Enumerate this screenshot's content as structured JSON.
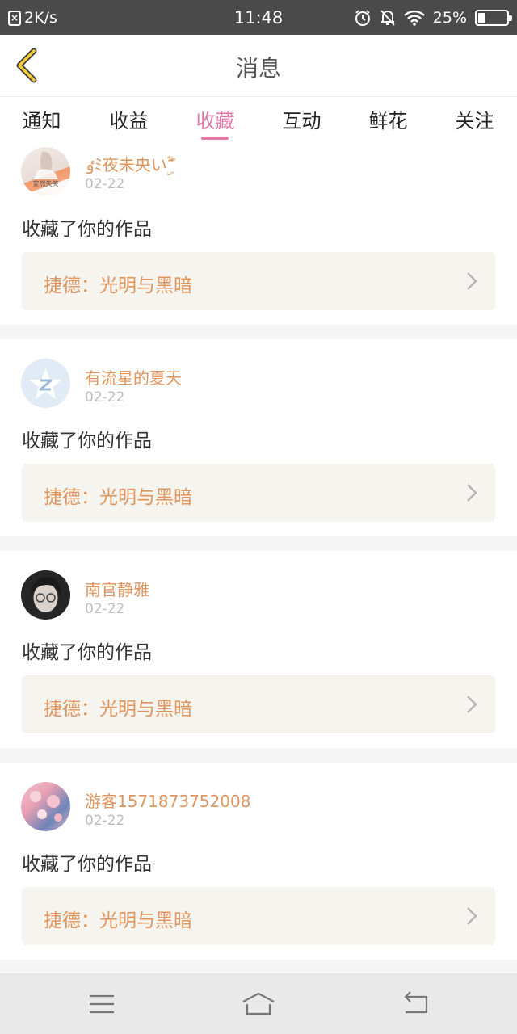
{
  "status_bar": {
    "speed": "2K/s",
    "time": "11:48",
    "battery": "25%",
    "battery_level": 0.25
  },
  "header": {
    "title": "消息"
  },
  "tabs": [
    {
      "label": "通知"
    },
    {
      "label": "收益"
    },
    {
      "label": "收藏"
    },
    {
      "label": "互动"
    },
    {
      "label": "鲜花"
    },
    {
      "label": "关注"
    }
  ],
  "active_tab": "收藏",
  "colors": {
    "accent": "#e07aa5",
    "username": "#e0955e",
    "status_bar": "#4a4a4a"
  },
  "feed": [
    {
      "username": "ٶﾐ夜未央いۣۖۗۘ",
      "date": "02-22",
      "action": "收藏了你的作品",
      "work_title": "捷德：光明与黑暗",
      "avatar_badge": "安然失笑"
    },
    {
      "username": "有流星的夏天",
      "date": "02-22",
      "action": "收藏了你的作品",
      "work_title": "捷德：光明与黑暗"
    },
    {
      "username": "南官静雅",
      "date": "02-22",
      "action": "收藏了你的作品",
      "work_title": "捷德：光明与黑暗"
    },
    {
      "username": "游客1571873752008",
      "date": "02-22",
      "action": "收藏了你的作品",
      "work_title": "捷德：光明与黑暗"
    }
  ]
}
